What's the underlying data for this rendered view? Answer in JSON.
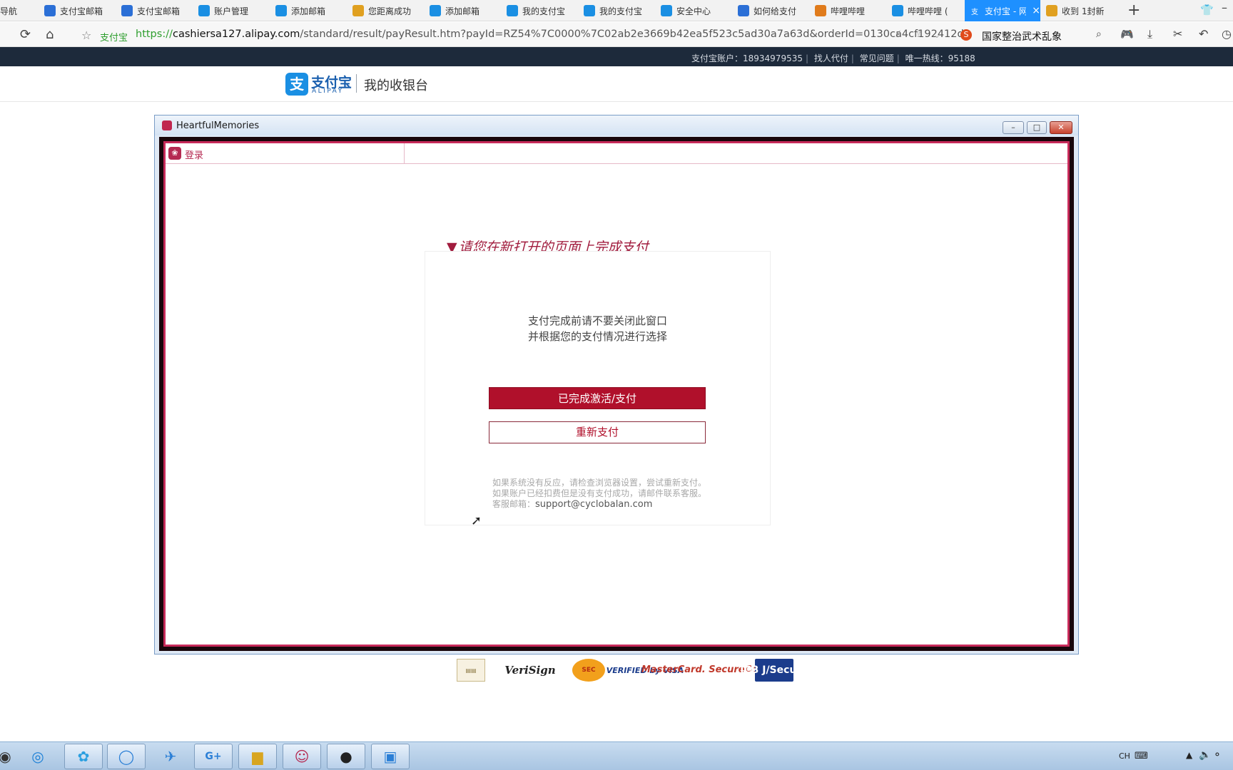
{
  "browser": {
    "tabs": [
      {
        "label": "导航",
        "icon": "home-icon",
        "color": "#888888"
      },
      {
        "label": "支付宝邮箱",
        "icon": "baidu-paw-icon",
        "color": "#2b6fd6"
      },
      {
        "label": "支付宝邮箱",
        "icon": "baidu-paw-icon",
        "color": "#2b6fd6"
      },
      {
        "label": "账户管理",
        "icon": "alipay-icon",
        "color": "#1a8fe3"
      },
      {
        "label": "添加邮箱",
        "icon": "alipay-icon",
        "color": "#1a8fe3"
      },
      {
        "label": "您距离成功",
        "icon": "chrome-icon",
        "color": "#e0a020"
      },
      {
        "label": "添加邮箱",
        "icon": "alipay-icon",
        "color": "#1a8fe3"
      },
      {
        "label": "我的支付宝",
        "icon": "alipay-icon",
        "color": "#1a8fe3"
      },
      {
        "label": "我的支付宝",
        "icon": "alipay-icon",
        "color": "#1a8fe3"
      },
      {
        "label": "安全中心",
        "icon": "alipay-icon",
        "color": "#1a8fe3"
      },
      {
        "label": "如何给支付",
        "icon": "baidu-paw-icon",
        "color": "#2b6fd6"
      },
      {
        "label": "哔哩哔哩",
        "icon": "sogou-icon",
        "color": "#e07b1b"
      },
      {
        "label": "哔哩哔哩 (",
        "icon": "bilibili-icon",
        "color": "#1a8fe3"
      },
      {
        "label": "支付宝 - 网",
        "icon": "alipay-icon",
        "color": "#ffffff",
        "active": true
      },
      {
        "label": "收到 1封新",
        "icon": "chrome-icon",
        "color": "#e0a020"
      }
    ],
    "site_label": "支付宝",
    "url_scheme": "https://",
    "url_host": "cashiersa127.alipay.com",
    "url_path": "/standard/result/payResult.htm?payId=RZ54%7C0000%7C02ab2e3669b42ea5f523c5ad30a7a63d&orderId=0130ca4cf192412d",
    "search_hint": "国家整治武术乱象"
  },
  "alipay": {
    "topbar": {
      "account": "支付宝账户：18934979535",
      "link1": "找人代付",
      "link2": "常见问题",
      "hotline": "唯一热线：95188"
    },
    "logo_text": "支付宝",
    "logo_sub": "ALIPAY",
    "cashier_title": "我的收银台"
  },
  "app": {
    "title": "HeartfulMemories",
    "login_label": "登录",
    "heading": "请您在新打开的页面上完成支付",
    "message_line1": "支付完成前请不要关闭此窗口",
    "message_line2": "并根据您的支付情况进行选择",
    "btn_done": "已完成激活/支付",
    "btn_retry": "重新支付",
    "hint_line1": "如果系统没有反应，请检查浏览器设置，尝试重新支付。",
    "hint_line2": "如果账户已经扣费但是没有支付成功，请邮件联系客服。",
    "hint_label": "客服邮箱：",
    "support_email": "support@cyclobalan.com"
  },
  "badges": {
    "verisign": "VeriSign",
    "visa": "VERIFIED by VISA",
    "mastercard": "MasterCard. SecureCode.",
    "jcb": "JCB J/Secure"
  },
  "tray": {
    "lang": "CH"
  }
}
